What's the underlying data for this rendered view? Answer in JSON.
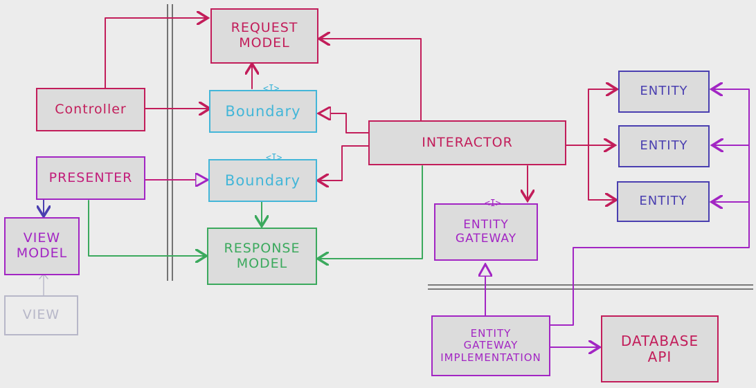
{
  "diagram": {
    "nodes": {
      "request_model": "REQUEST\nMODEL",
      "controller": "Controller",
      "boundary_input": "Boundary",
      "boundary_output": "Boundary",
      "interactor": "INTERACTOR",
      "presenter": "PRESENTER",
      "view_model": "VIEW\nMODEL",
      "view": "VIEW",
      "response_model": "RESPONSE\nMODEL",
      "entity_gateway": "ENTITY\nGATEWAY",
      "entity_gateway_impl": "ENTITY\nGATEWAY\nIMPLEMENTATION",
      "database_api": "DATABASE\nAPI",
      "entity_1": "ENTITY",
      "entity_2": "ENTITY",
      "entity_3": "ENTITY"
    },
    "interface_marker": "<I>"
  },
  "colors": {
    "red": "#c21d5a",
    "cyan": "#43b6d8",
    "green": "#3ba95d",
    "purple": "#a225c3",
    "magenta": "#c21d7a",
    "blue": "#4a3fb0",
    "gray": "#b7b7c8"
  }
}
